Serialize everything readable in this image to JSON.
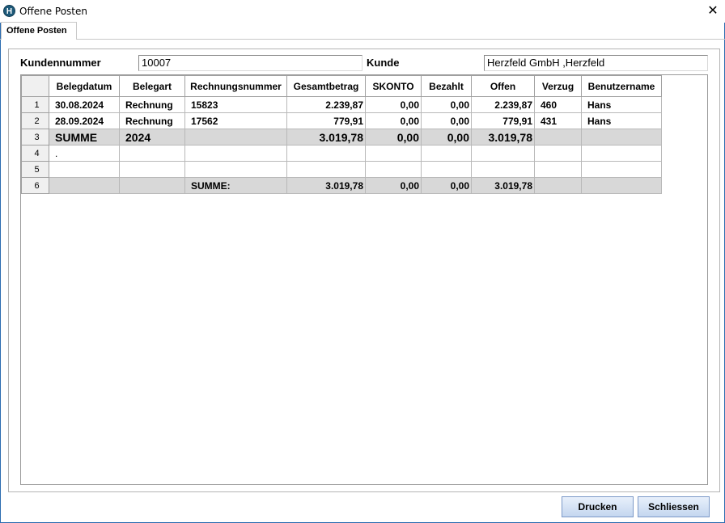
{
  "window": {
    "title": "Offene Posten",
    "app_icon_letter": "H"
  },
  "tab": {
    "label": "Offene Posten"
  },
  "form": {
    "kundennummer_label": "Kundennummer",
    "kundennummer_value": "10007",
    "kunde_label": "Kunde",
    "kunde_value": "Herzfeld GmbH  ,Herzfeld"
  },
  "grid": {
    "columns": [
      "Belegdatum",
      "Belegart",
      "Rechnungsnummer",
      "Gesamtbetrag",
      "SKONTO",
      "Bezahlt",
      "Offen",
      "Verzug",
      "Benutzername"
    ],
    "rows": [
      {
        "num": "1",
        "cells": [
          "30.08.2024",
          "Rechnung",
          "15823",
          "2.239,87",
          "0,00",
          "0,00",
          "2.239,87",
          "460",
          "Hans"
        ]
      },
      {
        "num": "2",
        "cells": [
          "28.09.2024",
          "Rechnung",
          "17562",
          "779,91",
          "0,00",
          "0,00",
          "779,91",
          "431",
          "Hans"
        ]
      },
      {
        "num": "3",
        "cells": [
          "SUMME",
          "2024",
          "",
          "3.019,78",
          "0,00",
          "0,00",
          "3.019,78",
          "",
          ""
        ]
      },
      {
        "num": "4",
        "cells": [
          ".",
          "",
          "",
          "",
          "",
          "",
          "",
          "",
          ""
        ]
      },
      {
        "num": "5",
        "cells": [
          "",
          "",
          "",
          "",
          "",
          "",
          "",
          "",
          ""
        ]
      },
      {
        "num": "6",
        "cells": [
          "",
          "",
          "SUMME:",
          "3.019,78",
          "0,00",
          "0,00",
          "3.019,78",
          "",
          ""
        ]
      }
    ]
  },
  "buttons": {
    "print": "Drucken",
    "close": "Schliessen"
  },
  "icons": {
    "close": "close-icon",
    "app": "app-logo-icon"
  }
}
